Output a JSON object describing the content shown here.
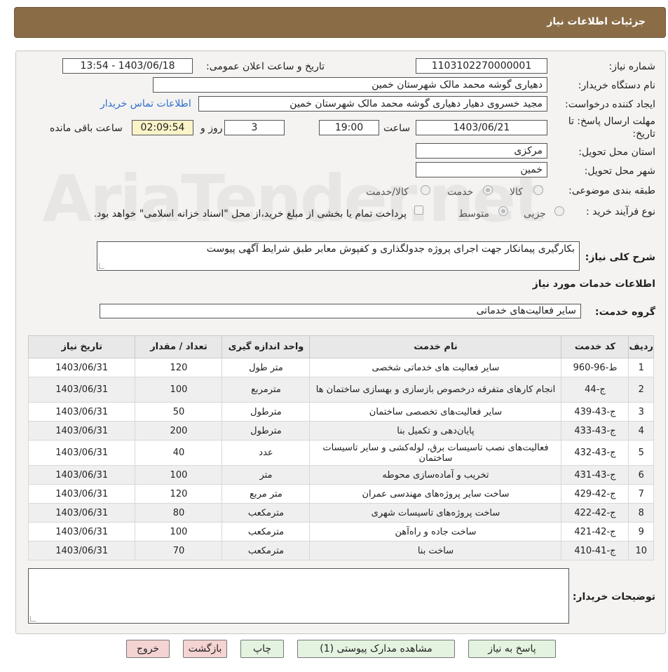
{
  "header": {
    "title": "جزئیات اطلاعات نیاز"
  },
  "watermark": "AriaTender.net",
  "form": {
    "need_number_label": "شماره نیاز:",
    "need_number": "1103102270000001",
    "announce_label": "تاریخ و ساعت اعلان عمومی:",
    "announce_value": "1403/06/18 - 13:54",
    "buyer_org_label": "نام دستگاه خریدار:",
    "buyer_org": "دهیاری گوشه محمد مالک شهرستان خمین",
    "creator_label": "ایجاد کننده درخواست:",
    "creator": "مجید خسروی دهیار دهیاری گوشه محمد مالک شهرستان خمین",
    "contact_link": "اطلاعات تماس خریدار",
    "deadline_label_1": "مهلت ارسال پاسخ: تا",
    "deadline_label_2": "تاریخ:",
    "deadline_date": "1403/06/21",
    "hour_label": "ساعت",
    "deadline_hour": "19:00",
    "days_value": "3",
    "days_label": "روز و",
    "remaining_time": "02:09:54",
    "remaining_label": "ساعت باقی مانده",
    "province_label": "استان محل تحویل:",
    "province": "مرکزی",
    "city_label": "شهر محل تحویل:",
    "city": "خمین",
    "category_label": "طبقه بندی موضوعی:",
    "category_options": [
      "کالا",
      "خدمت",
      "کالا/خدمت"
    ],
    "category_selected": "خدمت",
    "process_label": "نوع فرآیند خرید :",
    "process_options": [
      "جزیی",
      "متوسط"
    ],
    "process_selected": "متوسط",
    "payment_note": "پرداخت تمام یا بخشی از مبلغ خرید،از محل \"اسناد خزانه اسلامی\" خواهد بود.",
    "summary_label": "شرح کلی نیاز:",
    "summary": "بکارگیری پیمانکار جهت اجرای پروژه جدولگذاری و کفپوش معابر طبق شرایط آگهی پیوست",
    "services_title": "اطلاعات خدمات مورد نیاز",
    "service_group_label": "گروه خدمت:",
    "service_group": "سایر فعالیت‌های خدماتی",
    "buyer_notes_label": "توضیحات خریدار:",
    "buyer_notes": ""
  },
  "table": {
    "headers": [
      "ردیف",
      "کد خدمت",
      "نام خدمت",
      "واحد اندازه گیری",
      "تعداد / مقدار",
      "تاریخ نیاز"
    ],
    "rows": [
      {
        "idx": "1",
        "code": "ط-96-960",
        "name": "سایر فعالیت های خدماتی شخصی",
        "unit": "متر طول",
        "qty": "120",
        "date": "1403/06/31"
      },
      {
        "idx": "2",
        "code": "ج-44",
        "name": "انجام کارهای متفرقه درخصوص بازسازی و بهسازی ساختمان ها",
        "unit": "مترمربع",
        "qty": "100",
        "date": "1403/06/31"
      },
      {
        "idx": "3",
        "code": "ج-43-439",
        "name": "سایر فعالیت‌های تخصصی ساختمان",
        "unit": "مترطول",
        "qty": "50",
        "date": "1403/06/31"
      },
      {
        "idx": "4",
        "code": "ج-43-433",
        "name": "پایان‌دهی و تکمیل بنا",
        "unit": "مترطول",
        "qty": "200",
        "date": "1403/06/31"
      },
      {
        "idx": "5",
        "code": "ج-43-432",
        "name": "فعالیت‌های نصب تاسیسات برق، لوله‌کشی و سایر تاسیسات ساختمان",
        "unit": "عدد",
        "qty": "40",
        "date": "1403/06/31"
      },
      {
        "idx": "6",
        "code": "ج-43-431",
        "name": "تخریب و آماده‌سازی محوطه",
        "unit": "متر",
        "qty": "100",
        "date": "1403/06/31"
      },
      {
        "idx": "7",
        "code": "ج-42-429",
        "name": "ساخت سایر پروژه‌های مهندسی عمران",
        "unit": "متر مربع",
        "qty": "120",
        "date": "1403/06/31"
      },
      {
        "idx": "8",
        "code": "ج-42-422",
        "name": "ساخت پروژه‌های تاسیسات شهری",
        "unit": "مترمکعب",
        "qty": "80",
        "date": "1403/06/31"
      },
      {
        "idx": "9",
        "code": "ج-42-421",
        "name": "ساخت جاده و راه‌آهن",
        "unit": "مترمکعب",
        "qty": "100",
        "date": "1403/06/31"
      },
      {
        "idx": "10",
        "code": "ج-41-410",
        "name": "ساخت بنا",
        "unit": "مترمکعب",
        "qty": "70",
        "date": "1403/06/31"
      }
    ]
  },
  "buttons": {
    "reply": "پاسخ به نیاز",
    "view_docs": "مشاهده مدارک پیوستی (1)",
    "print": "چاپ",
    "back": "بازگشت",
    "exit": "خروج"
  }
}
